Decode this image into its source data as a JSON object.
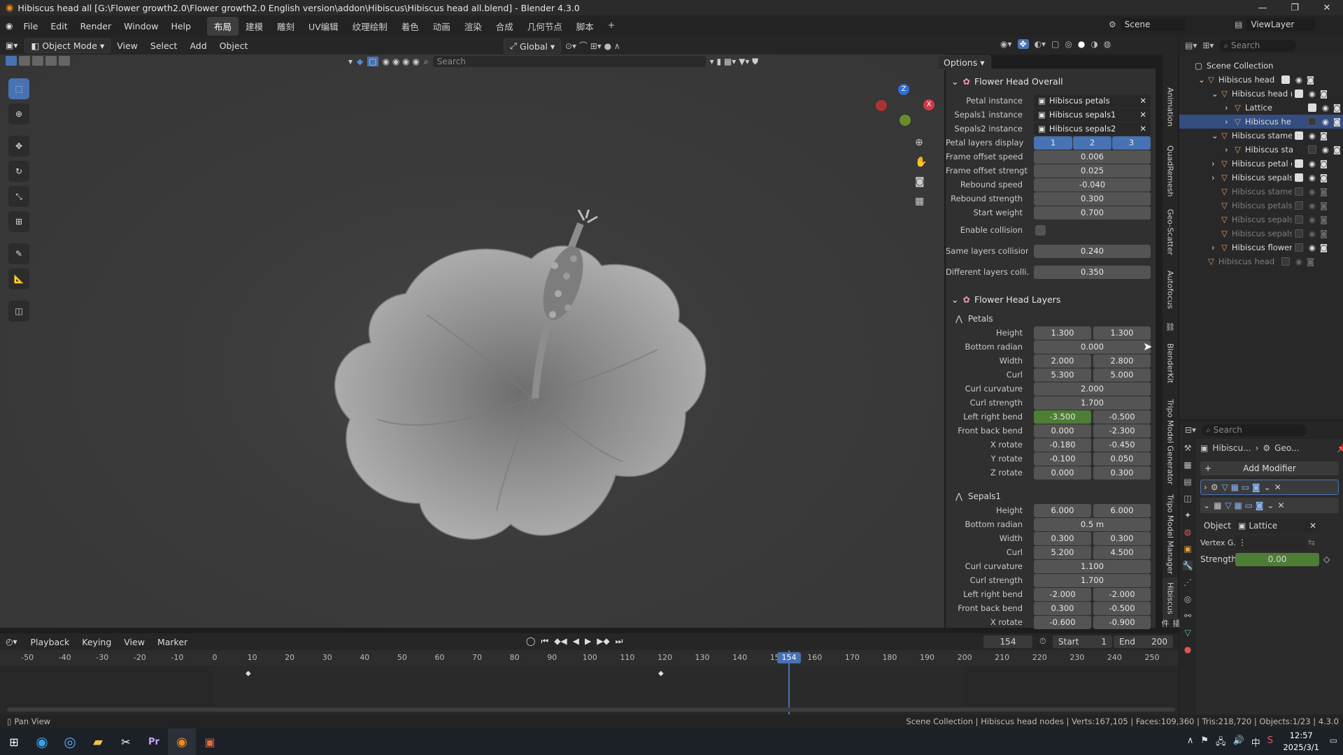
{
  "window": {
    "title": "Hibiscus head all [G:\\Flower growth2.0\\Flower growth2.0 English version\\addon\\Hibiscus\\Hibiscus head all.blend] - Blender 4.3.0"
  },
  "menu": [
    "File",
    "Edit",
    "Render",
    "Window",
    "Help"
  ],
  "workspaces": [
    "布局",
    "建模",
    "雕刻",
    "UV编辑",
    "纹理绘制",
    "着色",
    "动画",
    "渲染",
    "合成",
    "几何节点",
    "脚本"
  ],
  "scene": "Scene",
  "viewlayer": "ViewLayer",
  "viewport": {
    "mode": "Object Mode",
    "menus": [
      "View",
      "Select",
      "Add",
      "Object"
    ],
    "transform": "Global",
    "search_placeholder": "Search",
    "options": "Options"
  },
  "gizmo": {
    "z": "Z",
    "x": "X"
  },
  "side_tabs": [
    "Animation",
    "QuadRemesh",
    "Geo-Scatter",
    "Autofocus",
    "BlenderKit",
    "Tripo Model Generator",
    "Tripo Model Manager",
    "Hibiscus",
    "插件"
  ],
  "overall": {
    "title": "Flower Head Overall",
    "petal_instance_label": "Petal instance",
    "petal_instance": "Hibiscus petals",
    "sepals1_label": "Sepals1 instance",
    "sepals1": "Hibiscus sepals1",
    "sepals2_label": "Sepals2 instance",
    "sepals2": "Hibiscus sepals2",
    "layers_label": "Petal layers display",
    "layers": [
      "1",
      "2",
      "3"
    ],
    "rows": [
      {
        "label": "Frame offset speed",
        "value": "0.006"
      },
      {
        "label": "Frame offset strength",
        "value": "0.025"
      },
      {
        "label": "Rebound speed",
        "value": "-0.040"
      },
      {
        "label": "Rebound strength",
        "value": "0.300"
      },
      {
        "label": "Start weight",
        "value": "0.700"
      }
    ],
    "enable_collision": "Enable collision",
    "same_label": "Same layers collision",
    "same": "0.240",
    "diff_label": "Different layers colli...",
    "diff": "0.350"
  },
  "layers": {
    "title": "Flower Head Layers",
    "petals": {
      "title": "Petals",
      "rows": [
        {
          "label": "Height",
          "a": "1.300",
          "b": "1.300"
        },
        {
          "label": "Bottom radian",
          "full": "0.000"
        },
        {
          "label": "Width",
          "a": "2.000",
          "b": "2.800"
        },
        {
          "label": "Curl",
          "a": "5.300",
          "b": "5.000"
        },
        {
          "label": "Curl curvature",
          "full": "2.000"
        },
        {
          "label": "Curl strength",
          "full": "1.700"
        },
        {
          "label": "Left right bend",
          "a": "-3.500",
          "b": "-0.500",
          "green": true
        },
        {
          "label": "Front back bend",
          "a": "0.000",
          "b": "-2.300"
        },
        {
          "label": "X rotate",
          "a": "-0.180",
          "b": "-0.450"
        },
        {
          "label": "Y rotate",
          "a": "-0.100",
          "b": "0.050"
        },
        {
          "label": "Z rotate",
          "a": "0.000",
          "b": "0.300"
        }
      ]
    },
    "sepals1": {
      "title": "Sepals1",
      "rows": [
        {
          "label": "Height",
          "a": "6.000",
          "b": "6.000"
        },
        {
          "label": "Bottom radian",
          "full": "0.5 m"
        },
        {
          "label": "Width",
          "a": "0.300",
          "b": "0.300"
        },
        {
          "label": "Curl",
          "a": "5.200",
          "b": "4.500"
        },
        {
          "label": "Curl curvature",
          "full": "1.100"
        },
        {
          "label": "Curl strength",
          "full": "1.700"
        },
        {
          "label": "Left right bend",
          "a": "-2.000",
          "b": "-2.000"
        },
        {
          "label": "Front back bend",
          "a": "0.300",
          "b": "-0.500"
        },
        {
          "label": "X rotate",
          "a": "-0.600",
          "b": "-0.900"
        }
      ]
    }
  },
  "outliner": {
    "search": "Search",
    "root": "Scene Collection",
    "items": [
      {
        "label": "Hibiscus head",
        "indent": 1,
        "exp": "v",
        "vis": true,
        "chk": true,
        "sel": false,
        "dim": false
      },
      {
        "label": "Hibiscus head r",
        "indent": 2,
        "exp": "v",
        "vis": true,
        "chk": true,
        "sel": false,
        "dim": false
      },
      {
        "label": "Lattice",
        "indent": 3,
        "exp": ">",
        "vis": true,
        "chk": true,
        "sel": false,
        "dim": false
      },
      {
        "label": "Hibiscus he",
        "indent": 3,
        "exp": ">",
        "vis": true,
        "chk": false,
        "sel": true,
        "dim": false
      },
      {
        "label": "Hibiscus stame",
        "indent": 2,
        "exp": "v",
        "vis": true,
        "chk": true,
        "sel": false,
        "dim": false
      },
      {
        "label": "Hibiscus sta",
        "indent": 3,
        "exp": ">",
        "vis": true,
        "chk": false,
        "sel": false,
        "dim": false
      },
      {
        "label": "Hibiscus petal c",
        "indent": 2,
        "exp": ">",
        "vis": true,
        "chk": true,
        "sel": false,
        "dim": false
      },
      {
        "label": "Hibiscus sepals",
        "indent": 2,
        "exp": ">",
        "vis": true,
        "chk": true,
        "sel": false,
        "dim": false
      },
      {
        "label": "Hibiscus stame",
        "indent": 2,
        "exp": "",
        "vis": false,
        "chk": false,
        "sel": false,
        "dim": true
      },
      {
        "label": "Hibiscus petals",
        "indent": 2,
        "exp": "",
        "vis": false,
        "chk": false,
        "sel": false,
        "dim": true
      },
      {
        "label": "Hibiscus sepals",
        "indent": 2,
        "exp": "",
        "vis": false,
        "chk": false,
        "sel": false,
        "dim": true
      },
      {
        "label": "Hibiscus sepals",
        "indent": 2,
        "exp": "",
        "vis": false,
        "chk": false,
        "sel": false,
        "dim": true
      },
      {
        "label": "Hibiscus flower",
        "indent": 2,
        "exp": ">",
        "vis": true,
        "chk": false,
        "sel": false,
        "dim": false
      },
      {
        "label": "Hibiscus head",
        "indent": 1,
        "exp": "",
        "vis": false,
        "chk": false,
        "sel": false,
        "dim": true
      }
    ]
  },
  "properties": {
    "search": "Search",
    "crumb1": "Hibiscu...",
    "crumb2": "Geo...",
    "add_modifier": "Add Modifier",
    "object_label": "Object",
    "object": "Lattice",
    "vgroup_label": "Vertex G...",
    "strength_label": "Strength",
    "strength": "0.00"
  },
  "timeline": {
    "menus": [
      "Playback",
      "Keying",
      "View",
      "Marker"
    ],
    "current": "154",
    "start_label": "Start",
    "start": "1",
    "end_label": "End",
    "end": "200",
    "ticks": [
      "-50",
      "-40",
      "-30",
      "-20",
      "-10",
      "0",
      "10",
      "20",
      "30",
      "40",
      "50",
      "60",
      "70",
      "80",
      "90",
      "100",
      "110",
      "120",
      "130",
      "140",
      "150",
      "160",
      "170",
      "180",
      "190",
      "200",
      "210",
      "220",
      "230",
      "240",
      "250"
    ]
  },
  "status": {
    "left": "Pan View",
    "right": "Scene Collection | Hibiscus head nodes | Verts:167,105 | Faces:109,360 | Tris:218,720 | Objects:1/23 | 4.3.0"
  },
  "taskbar": {
    "time": "12:57",
    "date": "2025/3/1",
    "ime": "中"
  },
  "colors": {
    "accent": "#4772b3",
    "green": "#4e7d36",
    "selected": "#334d80"
  }
}
